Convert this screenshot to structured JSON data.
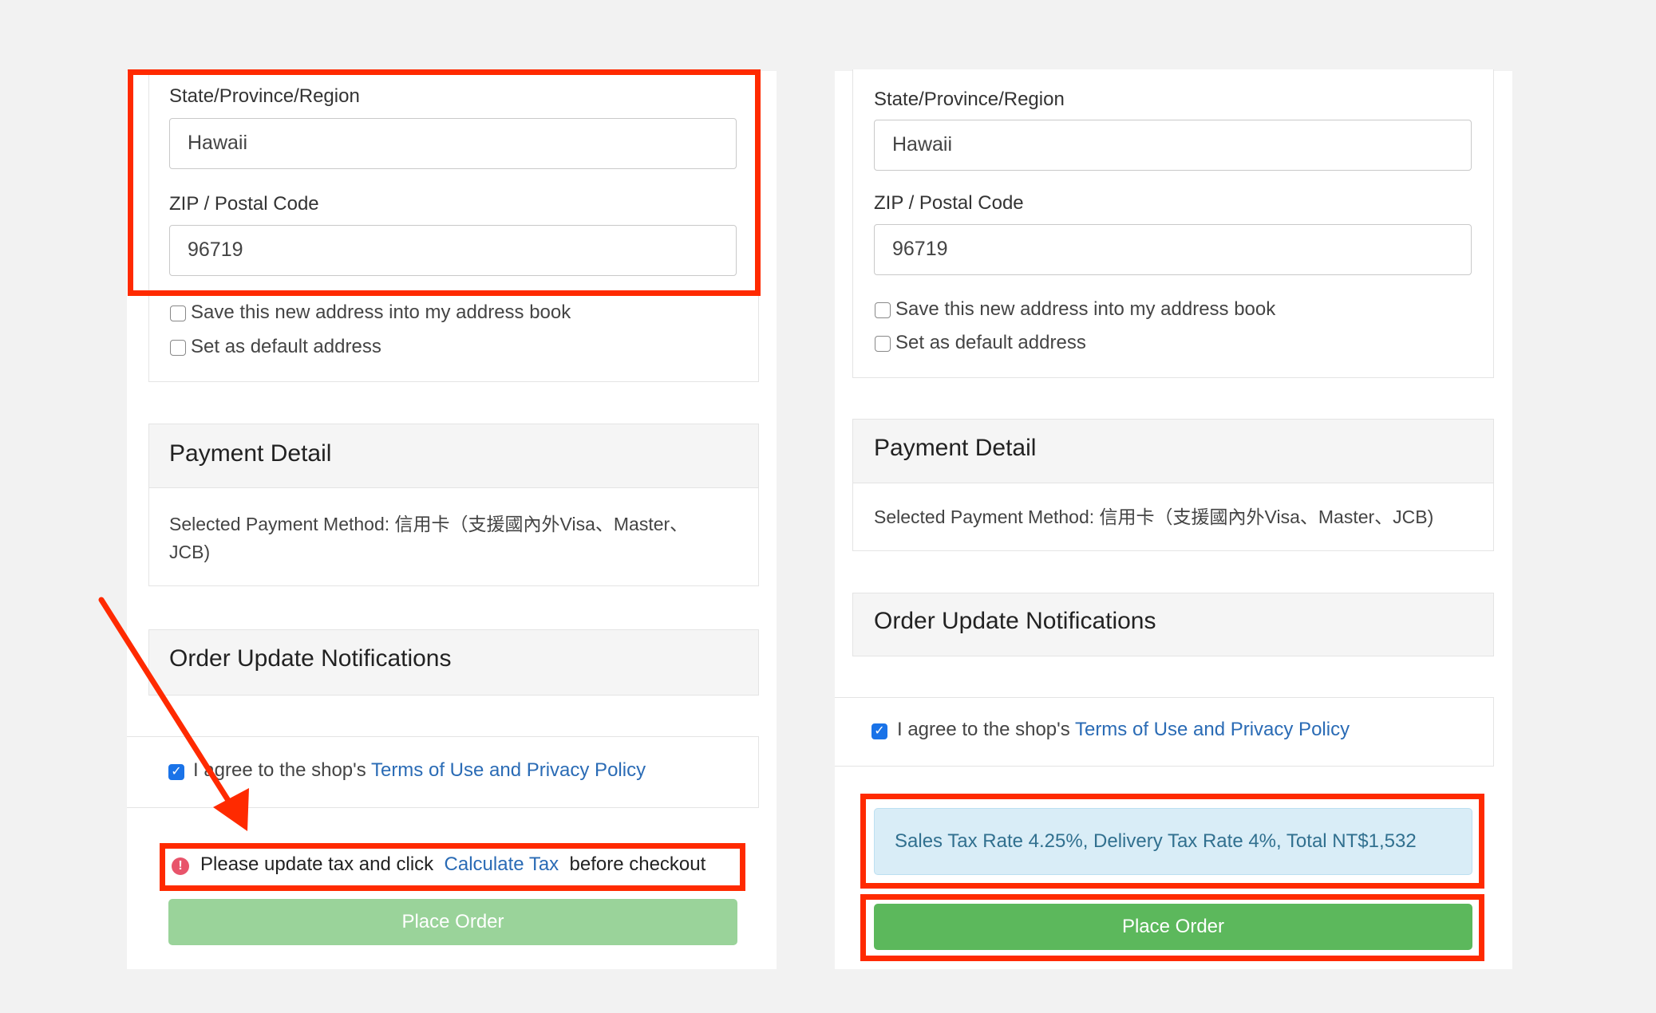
{
  "left": {
    "state_label": "State/Province/Region",
    "state_value": "Hawaii",
    "zip_label": "ZIP / Postal Code",
    "zip_value": "96719",
    "save_address_label": "Save this new address into my address book",
    "default_address_label": "Set as default address",
    "payment_title": "Payment Detail",
    "payment_line1": "Selected Payment Method: 信用卡（支援國內外Visa、Master、",
    "payment_line2": "JCB)",
    "notifications_title": "Order Update Notifications",
    "agree_text": "I agree to the shop's ",
    "agree_link": "Terms of Use and Privacy Policy",
    "warning_before": "Please update tax and click ",
    "warning_link": "Calculate Tax",
    "warning_after": " before checkout",
    "place_order_label": "Place Order"
  },
  "right": {
    "state_label": "State/Province/Region",
    "state_value": "Hawaii",
    "zip_label": "ZIP / Postal Code",
    "zip_value": "96719",
    "save_address_label": "Save this new address into my address book",
    "default_address_label": "Set as default address",
    "payment_title": "Payment Detail",
    "payment_line1": "Selected Payment Method: 信用卡（支援國內外Visa、Master、JCB)",
    "notifications_title": "Order Update Notifications",
    "agree_text": "I agree to the shop's ",
    "agree_link": "Terms of Use and Privacy Policy",
    "tax_info": "Sales Tax Rate 4.25%, Delivery Tax Rate 4%, Total NT$1,532",
    "place_order_label": "Place Order"
  },
  "colors": {
    "highlight": "#ff2a00",
    "link": "#2a6bb5",
    "button_enabled": "#5cb85c",
    "button_disabled": "#9ad39a",
    "info_bg": "#d9edf7",
    "info_text": "#31708f",
    "warning_icon": "#e8546b"
  }
}
